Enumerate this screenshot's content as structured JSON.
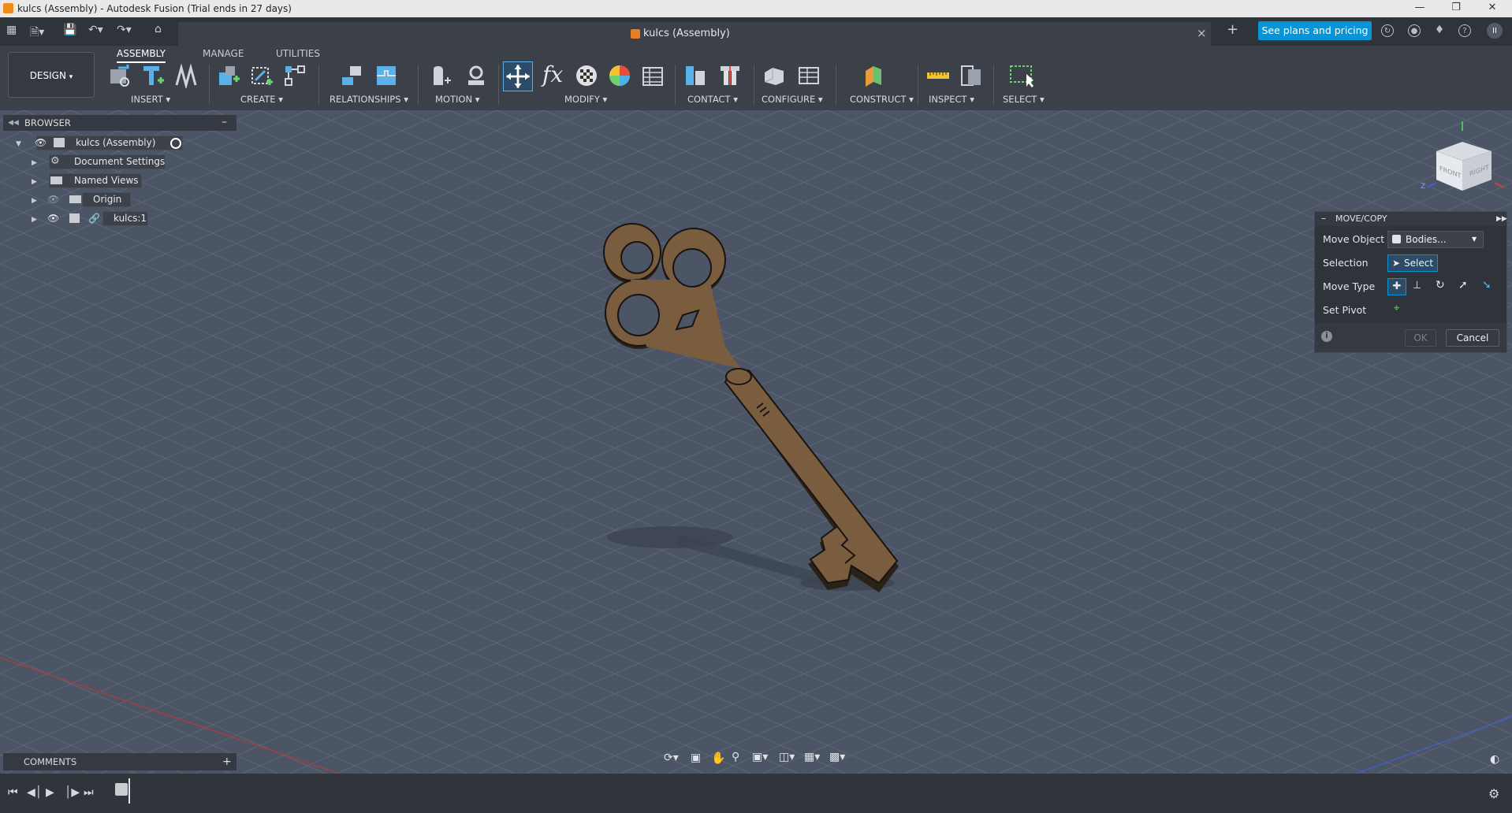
{
  "window": {
    "title": "kulcs (Assembly) - Autodesk Fusion (Trial ends in 27 days)"
  },
  "appbar": {
    "doc_tab": "kulcs (Assembly)",
    "plans_button": "See plans and pricing",
    "close_tab": "×",
    "new_tab": "+",
    "user_initials": "II"
  },
  "ribbon": {
    "tabs": [
      "ASSEMBLY",
      "MANAGE",
      "UTILITIES"
    ],
    "workspace": "DESIGN",
    "groups": [
      "INSERT",
      "CREATE",
      "RELATIONSHIPS",
      "MOTION",
      "MODIFY",
      "CONTACT",
      "CONFIGURE",
      "CONSTRUCT",
      "INSPECT",
      "SELECT"
    ]
  },
  "browser": {
    "title": "BROWSER",
    "root": "kulcs (Assembly)",
    "items": [
      "Document Settings",
      "Named Views",
      "Origin",
      "kulcs:1"
    ]
  },
  "comments": {
    "title": "COMMENTS",
    "add": "+"
  },
  "movecopy": {
    "title": "MOVE/COPY",
    "move_object_label": "Move Object",
    "move_object_value": "Bodies...",
    "selection_label": "Selection",
    "selection_value": "Select",
    "move_type_label": "Move Type",
    "set_pivot_label": "Set Pivot",
    "ok": "OK",
    "cancel": "Cancel"
  },
  "viewcube": {
    "front": "FRONT",
    "right": "RIGHT"
  },
  "colors": {
    "viewport_bg": "#4b5565",
    "key_body": "#7a5c3e",
    "accent_blue": "#0696d7"
  }
}
